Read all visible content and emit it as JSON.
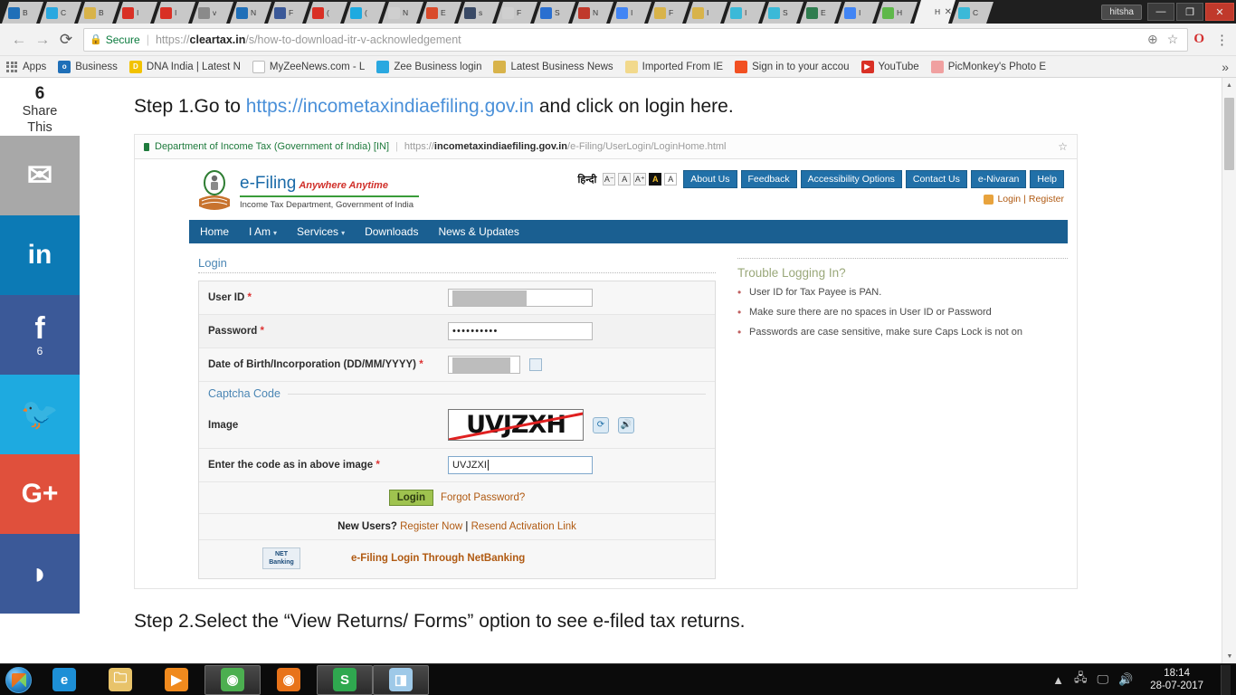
{
  "browser": {
    "profile_name": "hitsha",
    "window_controls": {
      "minimize": "—",
      "maximize": "❐",
      "close": "✕"
    },
    "tabs": [
      {
        "label": "B",
        "icon": "outlook-icon",
        "color": "#1f6fb8",
        "active": false
      },
      {
        "label": "C",
        "icon": "water-drop-icon",
        "color": "#2aa8e0",
        "active": false
      },
      {
        "label": "B",
        "icon": "hourglass-icon",
        "color": "#d8b34a",
        "active": false
      },
      {
        "label": "I",
        "icon": "gmail-icon",
        "color": "#d93025",
        "active": false
      },
      {
        "label": "I",
        "icon": "gmail-icon",
        "color": "#d93025",
        "active": false
      },
      {
        "label": "v",
        "icon": "generic-icon",
        "color": "#8a8a8a",
        "active": false
      },
      {
        "label": "N",
        "icon": "outlook-icon",
        "color": "#1f6fb8",
        "active": false
      },
      {
        "label": "F",
        "icon": "facebook-icon",
        "color": "#3b5998",
        "active": false
      },
      {
        "label": "(",
        "icon": "youtube-icon",
        "color": "#d93025",
        "active": false
      },
      {
        "label": "(",
        "icon": "twitter-icon",
        "color": "#1eaae0",
        "active": false
      },
      {
        "label": "N",
        "icon": "page-icon",
        "color": "#cfcfcf",
        "active": false
      },
      {
        "label": "E",
        "icon": "opera-icon",
        "color": "#d94b2b",
        "active": false
      },
      {
        "label": "s",
        "icon": "grid-icon",
        "color": "#3a4a66",
        "active": false
      },
      {
        "label": "F",
        "icon": "page-icon",
        "color": "#cfcfcf",
        "active": false
      },
      {
        "label": "S",
        "icon": "grid-blue-icon",
        "color": "#2a6fd0",
        "active": false
      },
      {
        "label": "N",
        "icon": "opera-red-icon",
        "color": "#c0392b",
        "active": false
      },
      {
        "label": "I",
        "icon": "google-icon",
        "color": "#4285f4",
        "active": false
      },
      {
        "label": "F",
        "icon": "hourglass-icon",
        "color": "#d8b34a",
        "active": false
      },
      {
        "label": "I",
        "icon": "hourglass-icon",
        "color": "#d8b34a",
        "active": false
      },
      {
        "label": "I",
        "icon": "smiley-icon",
        "color": "#3bb9d8",
        "active": false
      },
      {
        "label": "S",
        "icon": "smiley-icon",
        "color": "#3bb9d8",
        "active": false
      },
      {
        "label": "E",
        "icon": "book-icon",
        "color": "#2f7d4f",
        "active": false
      },
      {
        "label": "I",
        "icon": "google-icon",
        "color": "#4285f4",
        "active": false
      },
      {
        "label": "H",
        "icon": "green-square-icon",
        "color": "#5fb84a",
        "active": false
      },
      {
        "label": "H",
        "icon": "active-tab-icon",
        "color": "#f2f2f2",
        "active": true,
        "close": "✕"
      },
      {
        "label": "C",
        "icon": "smiley-icon",
        "color": "#3bb9d8",
        "active": false
      }
    ],
    "omnibox": {
      "back_label": "←",
      "forward_label": "→",
      "reload_label": "⟳",
      "lock_icon": "lock-icon",
      "secure_label": "Secure",
      "separator": "|",
      "url_prefix": "https://",
      "url_domain": "cleartax.in",
      "url_path": "/s/how-to-download-itr-v-acknowledgement",
      "zoom_icon": "⊕",
      "star_icon": "☆",
      "opera_icon": "O",
      "menu_icon": "⋮"
    },
    "bookmarks": [
      {
        "label": "Apps",
        "icon": "apps-grid-icon",
        "color": "#7a7a7a"
      },
      {
        "label": "Business",
        "icon": "outlook-icon",
        "color": "#1f6fb8"
      },
      {
        "label": "DNA India | Latest N",
        "icon": "dna-icon",
        "color": "#f2c200"
      },
      {
        "label": "MyZeeNews.com - L",
        "icon": "page-icon",
        "color": "#ffffff"
      },
      {
        "label": "Zee Business login",
        "icon": "water-drop-icon",
        "color": "#2aa8e0"
      },
      {
        "label": "Latest Business News",
        "icon": "hourglass-icon",
        "color": "#d8b34a"
      },
      {
        "label": "Imported From IE",
        "icon": "folder-icon",
        "color": "#f2d98c"
      },
      {
        "label": "Sign in to your accou",
        "icon": "microsoft-icon",
        "color": "#f25022"
      },
      {
        "label": "YouTube",
        "icon": "youtube-icon",
        "color": "#d93025"
      },
      {
        "label": "PicMonkey's Photo E",
        "icon": "picmonkey-icon",
        "color": "#f0a0a0"
      }
    ],
    "bookmarks_overflow": "»"
  },
  "share_rail": {
    "count": "6",
    "label_line1": "Share",
    "label_line2": "This",
    "buttons": [
      {
        "name": "email-share",
        "glyph": "✉",
        "color": "#a8a8a8",
        "count": ""
      },
      {
        "name": "linkedin-share",
        "glyph": "in",
        "color": "#0c7ab5",
        "count": ""
      },
      {
        "name": "facebook-share",
        "glyph": "f",
        "color": "#3b5998",
        "count": "6"
      },
      {
        "name": "twitter-share",
        "glyph": "🐦",
        "color": "#1eaae0",
        "count": ""
      },
      {
        "name": "googleplus-share",
        "glyph": "G+",
        "color": "#e0503c",
        "count": ""
      },
      {
        "name": "messenger-share",
        "glyph": "◗",
        "color": "#3b5998",
        "count": ""
      }
    ]
  },
  "article": {
    "step1_prefix": "Step 1.Go to ",
    "step1_link": "https://incometaxindiaefiling.gov.in",
    "step1_suffix": " and click on login here.",
    "step2_text": "Step 2.Select the “View Returns/ Forms” option to see e-filed tax returns."
  },
  "embedded": {
    "omnibox": {
      "site_label": "Department of Income Tax (Government of India) [IN]",
      "separator": "|",
      "url_prefix": "https://",
      "url_domain": "incometaxindiaefiling.gov.in",
      "url_path": "/e-Filing/UserLogin/LoginHome.html",
      "star_icon": "☆"
    },
    "header": {
      "emblem_icon": "india-emblem-icon",
      "brand_title": "e-Filing",
      "brand_tagline": "Anywhere Anytime",
      "brand_sub": "Income Tax Department, Government of India",
      "hindi_label": "हिन्दी",
      "font_sizes": [
        "A⁻",
        "A",
        "A⁺"
      ],
      "contrast_buttons": [
        "A",
        "A"
      ],
      "nav_buttons": [
        "About Us",
        "Feedback",
        "Accessibility Options",
        "Contact Us",
        "e-Nivaran",
        "Help"
      ],
      "login_text": "Login",
      "login_sep": "|",
      "register_text": "Register"
    },
    "menubar": [
      {
        "label": "Home",
        "caret": false
      },
      {
        "label": "I Am",
        "caret": true
      },
      {
        "label": "Services",
        "caret": true
      },
      {
        "label": "Downloads",
        "caret": false
      },
      {
        "label": "News & Updates",
        "caret": false
      }
    ],
    "login_form": {
      "legend": "Login",
      "fields": [
        {
          "label": "User ID",
          "required": "*",
          "value": "",
          "masked": true,
          "type": "text"
        },
        {
          "label": "Password",
          "required": "*",
          "value": "••••••••••",
          "masked": false,
          "type": "password"
        },
        {
          "label": "Date of Birth/Incorporation (DD/MM/YYYY)",
          "required": "*",
          "value": "",
          "masked": true,
          "type": "date"
        }
      ],
      "captcha_legend": "Captcha Code",
      "captcha_image_label": "Image",
      "captcha_text": "UVJZXH",
      "refresh_icon": "refresh-icon",
      "audio_icon": "speaker-icon",
      "code_label": "Enter the code as in above image",
      "code_required": "*",
      "code_value": "UVJZXI",
      "submit_label": "Login",
      "forgot_label": "Forgot Password?",
      "newusers_prefix": "New Users?",
      "register_now": "Register Now",
      "links_sep": "|",
      "resend_link": "Resend Activation Link",
      "netbanking_logo_l1": "NET",
      "netbanking_logo_l2": "Banking",
      "netbanking_text": "e-Filing Login Through NetBanking"
    },
    "trouble": {
      "heading": "Trouble Logging In?",
      "items": [
        "User ID for Tax Payee is PAN.",
        "Make sure there are no spaces in User ID or Password",
        "Passwords are case sensitive, make sure Caps Lock is not on"
      ]
    }
  },
  "scrollbar": {
    "up_arrow": "▲",
    "down_arrow": "▼"
  },
  "taskbar": {
    "start_label": "start-orb",
    "apps": [
      {
        "name": "internet-explorer",
        "glyph": "e",
        "color": "#1d8fd6",
        "running": false
      },
      {
        "name": "file-explorer",
        "glyph": "🗀",
        "color": "#e8c36a",
        "running": false
      },
      {
        "name": "media-player",
        "glyph": "▶",
        "color": "#f08a1e",
        "running": false
      },
      {
        "name": "google-chrome",
        "glyph": "◉",
        "color": "#4caf50",
        "running": true
      },
      {
        "name": "mozilla-firefox",
        "glyph": "◉",
        "color": "#e8731a",
        "running": false
      },
      {
        "name": "snagit",
        "glyph": "S",
        "color": "#2fa84f",
        "running": true
      },
      {
        "name": "onenote",
        "glyph": "◨",
        "color": "#9ec9e8",
        "running": true
      }
    ],
    "tray": {
      "expand_icon": "▲",
      "network_icon": "network-icon",
      "display_icon": "display-icon",
      "volume_icon": "🔊",
      "time": "18:14",
      "date": "28-07-2017"
    }
  },
  "colors": {
    "chrome_bg": "#f2f2f2",
    "efiling_blue": "#1a5f91",
    "efiling_btn": "#2170a8",
    "login_green": "#9fc34f",
    "link_orange": "#b05a12",
    "accent_link": "#4a90d9"
  }
}
